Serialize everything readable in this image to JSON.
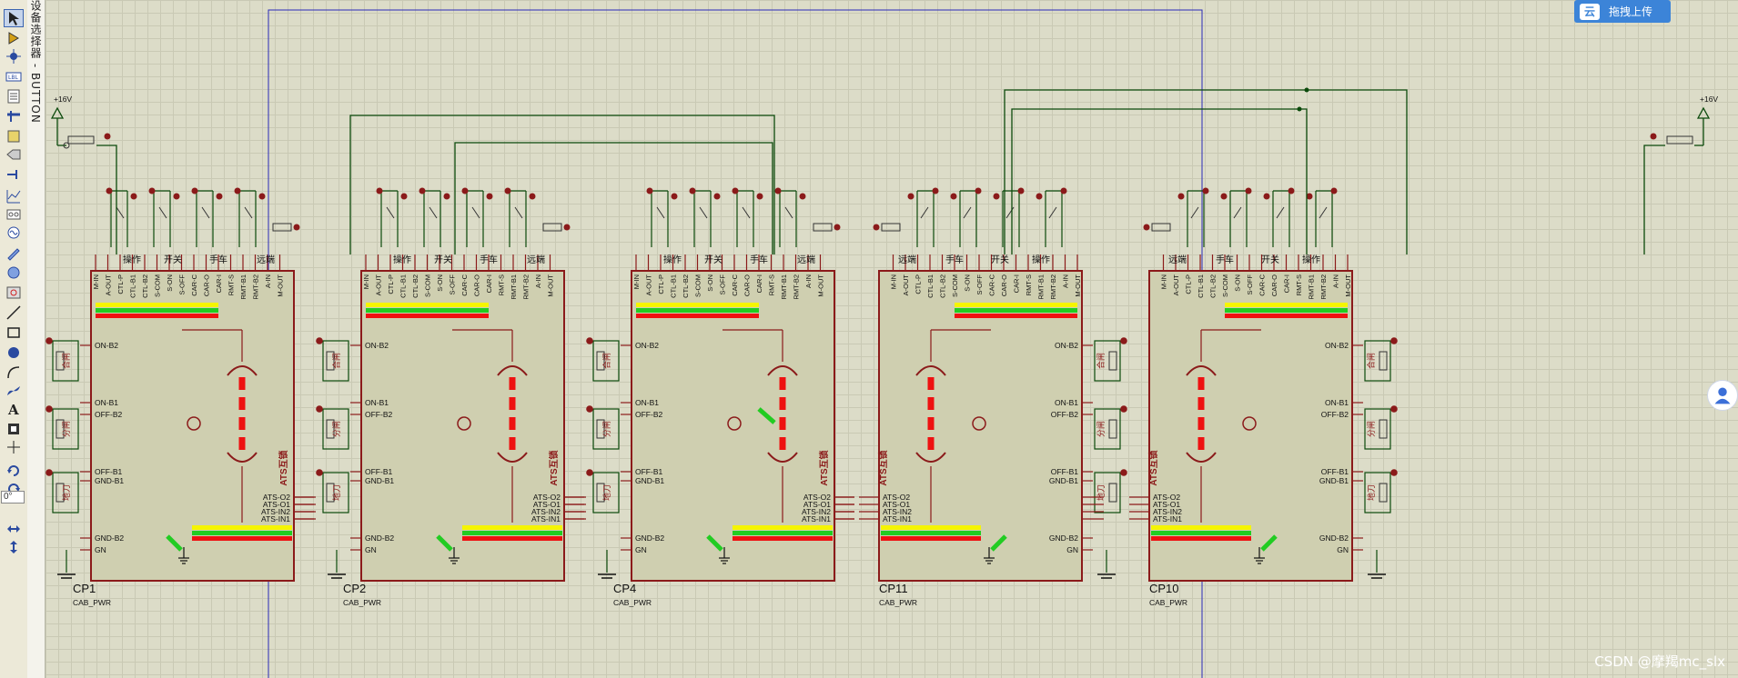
{
  "window": {
    "app": "Proteus ISIS"
  },
  "device_panel": {
    "title": "设备选择器 - BUTTON"
  },
  "toolbar": {
    "tools": [
      "selection-mode",
      "component-mode",
      "junction-dot",
      "wire-label",
      "text-script",
      "bus",
      "subcircuit",
      "terminal",
      "device-pin",
      "graph",
      "tape-recorder",
      "generator",
      "voltage-probe",
      "current-probe",
      "virtual-instrument",
      "line-2d",
      "box-2d",
      "circle-2d",
      "arc-2d",
      "path-2d",
      "text-2d",
      "symbol-2d",
      "marker-2d",
      "rotate-cw",
      "rotate-ccw",
      "flip-horizontal",
      "flip-vertical"
    ],
    "rotation_value": "0°"
  },
  "upload_button": {
    "label": "拖拽上传"
  },
  "watermark": "CSDN @摩羯mc_slx",
  "power": {
    "left": "+16V",
    "right": "+16V"
  },
  "blocks": [
    {
      "ref": "CP1",
      "value": "CAB_PWR",
      "mirror": false,
      "arm_tilt": false
    },
    {
      "ref": "CP2",
      "value": "CAB_PWR",
      "mirror": false,
      "arm_tilt": false
    },
    {
      "ref": "CP4",
      "value": "CAB_PWR",
      "mirror": false,
      "arm_tilt": true
    },
    {
      "ref": "CP11",
      "value": "CAB_PWR",
      "mirror": true,
      "arm_tilt": false
    },
    {
      "ref": "CP10",
      "value": "CAB_PWR",
      "mirror": true,
      "arm_tilt": false
    }
  ],
  "labels": {
    "top_pins": [
      "M-IN",
      "A-OUT",
      "CTL-P",
      "CTL-B1",
      "CTL-B2",
      "S-COM",
      "S-ON",
      "S-OFF",
      "CAR-C",
      "CAR-O",
      "CAR-I",
      "RMT-S",
      "RMT-B1",
      "RMT-B2",
      "A-IN",
      "M-OUT"
    ],
    "top_groups": [
      "操作",
      "开关",
      "手车",
      "远端"
    ],
    "side_pins": [
      "ON-B2",
      "ON-B1",
      "OFF-B2",
      "OFF-B1",
      "GND-B1",
      "GND-B2",
      "GN"
    ],
    "ats_pins": [
      "ATS-O2",
      "ATS-O1",
      "ATS-IN2",
      "ATS-IN1"
    ],
    "ats_title": "ATS互锁",
    "switch_labels": [
      "合闸",
      "分闸",
      "地刀"
    ]
  },
  "colors": {
    "wire": "#0b4a0b",
    "component": "#8b1a1a",
    "component_fill": "#cfcfb0",
    "led_red": "#8b0000",
    "bar_yellow": "#f5f500",
    "bar_green": "#22cc22",
    "bar_red": "#ee1111",
    "frame": "#2a2ab8"
  }
}
